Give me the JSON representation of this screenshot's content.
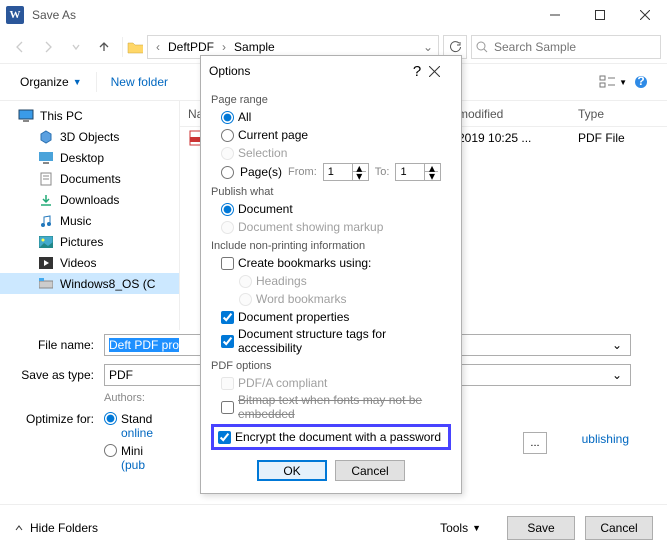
{
  "window": {
    "title": "Save As"
  },
  "breadcrumb": {
    "seg1": "DeftPDF",
    "seg2": "Sample"
  },
  "search": {
    "placeholder": "Search Sample"
  },
  "toolbar": {
    "organize": "Organize",
    "newfolder": "New folder"
  },
  "sidebar": {
    "pc": "This PC",
    "items": [
      "3D Objects",
      "Desktop",
      "Documents",
      "Downloads",
      "Music",
      "Pictures",
      "Videos",
      "Windows8_OS (C"
    ]
  },
  "cols": {
    "name": "Na",
    "mod": "modified",
    "type": "Type"
  },
  "file": {
    "date": "2019 10:25 ...",
    "type": "PDF File"
  },
  "form": {
    "filename_lab": "File name:",
    "filename_val": "Deft PDF pro",
    "type_lab": "Save as type:",
    "type_val": "PDF",
    "authors_lab": "Authors:",
    "optimize_lab": "Optimize for:",
    "opt1a": "Stand",
    "opt1b": "online",
    "opt2a": "Mini",
    "opt2b": "(pub",
    "opt_tail": "ublishing",
    "options_btn": "..."
  },
  "footer": {
    "hide": "Hide Folders",
    "tools": "Tools",
    "save": "Save",
    "cancel": "Cancel"
  },
  "dlg": {
    "title": "Options",
    "g1": "Page range",
    "all": "All",
    "cur": "Current page",
    "sel": "Selection",
    "pages": "Page(s)",
    "from": "From:",
    "to": "To:",
    "one": "1",
    "g2": "Publish what",
    "doc": "Document",
    "markup": "Document showing markup",
    "g3": "Include non-printing information",
    "bk": "Create bookmarks using:",
    "heads": "Headings",
    "wbk": "Word bookmarks",
    "dp": "Document properties",
    "dst": "Document structure tags for accessibility",
    "g4": "PDF options",
    "pdfa": "PDF/A compliant",
    "bitmap": "Bitmap text when fonts may not be embedded",
    "enc": "Encrypt the document with a password",
    "ok": "OK",
    "cancel": "Cancel"
  }
}
